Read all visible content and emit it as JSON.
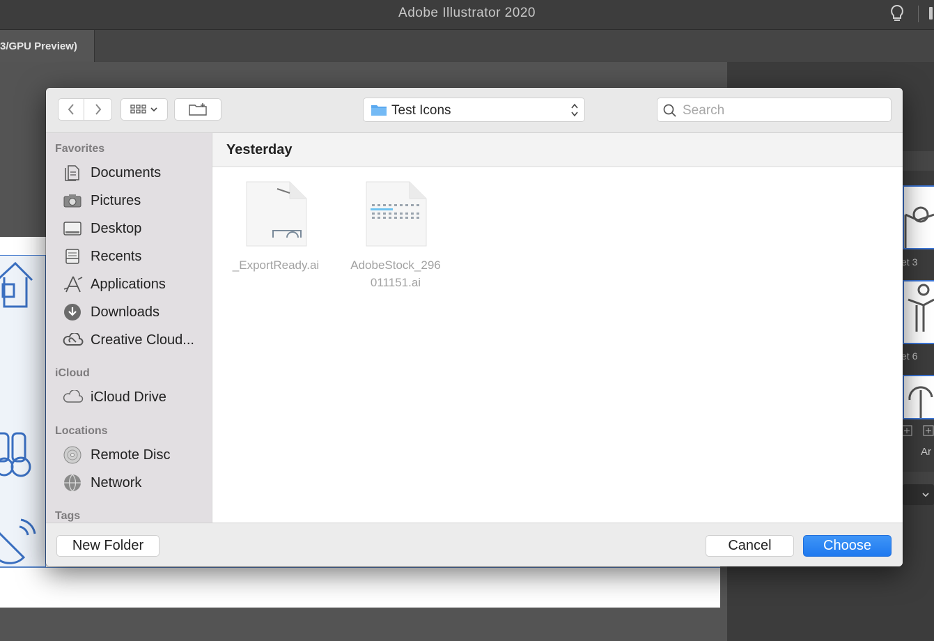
{
  "app": {
    "window_title": "Adobe Illustrator 2020",
    "doc_tab_label": "3/GPU Preview)"
  },
  "right_panel": {
    "thumb_labels": [
      "et 3",
      "et 6"
    ],
    "cut_text": "Ar"
  },
  "dialog": {
    "toolbar": {
      "back_icon": "chevron-left-icon",
      "forward_icon": "chevron-right-icon",
      "view_icon": "icon-grid-icon",
      "new_folder_icon": "folder-plus-icon",
      "location": "Test Icons",
      "search_placeholder": "Search"
    },
    "sidebar": {
      "favorites_heading": "Favorites",
      "favorites": [
        {
          "label": "Documents",
          "icon": "documents-icon"
        },
        {
          "label": "Pictures",
          "icon": "camera-icon"
        },
        {
          "label": "Desktop",
          "icon": "desktop-icon"
        },
        {
          "label": "Recents",
          "icon": "recents-icon"
        },
        {
          "label": "Applications",
          "icon": "applications-icon"
        },
        {
          "label": "Downloads",
          "icon": "download-icon"
        },
        {
          "label": "Creative Cloud...",
          "icon": "creative-cloud-icon"
        }
      ],
      "icloud_heading": "iCloud",
      "icloud": [
        {
          "label": "iCloud Drive",
          "icon": "cloud-icon"
        }
      ],
      "locations_heading": "Locations",
      "locations": [
        {
          "label": "Remote Disc",
          "icon": "disc-icon"
        },
        {
          "label": "Network",
          "icon": "globe-icon"
        }
      ],
      "tags_heading": "Tags"
    },
    "content": {
      "group_heading": "Yesterday",
      "files": [
        {
          "name": "_ExportReady.ai"
        },
        {
          "name_line1": "AdobeStock_296",
          "name_line2": "011151.ai"
        }
      ]
    },
    "buttons": {
      "new_folder": "New Folder",
      "cancel": "Cancel",
      "choose": "Choose"
    },
    "colors": {
      "accent": "#1f79ef",
      "folder": "#5aa9f0",
      "sidebar_bg": "#e2dfe2"
    }
  }
}
